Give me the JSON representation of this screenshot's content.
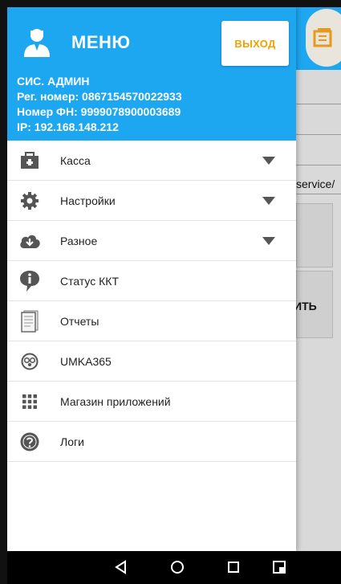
{
  "drawer": {
    "title": "МЕНЮ",
    "logout_label": "ВЫХОД",
    "user_name": "СИС. АДМИН",
    "reg_number": "Рег. номер: 0867154570022933",
    "fn_number": "Номер ФН: 9999078900003689",
    "ip": "IP: 192.168.148.212",
    "items": [
      {
        "label": "Касса",
        "icon": "cash-register-icon",
        "expandable": true
      },
      {
        "label": "Настройки",
        "icon": "gear-icon",
        "expandable": true
      },
      {
        "label": "Разное",
        "icon": "cloud-download-icon",
        "expandable": true
      },
      {
        "label": "Статус ККТ",
        "icon": "info-bubble-icon",
        "expandable": false
      },
      {
        "label": "Отчеты",
        "icon": "document-icon",
        "expandable": false
      },
      {
        "label": "UMKA365",
        "icon": "umka-logo-icon",
        "expandable": false
      },
      {
        "label": "Магазин приложений",
        "icon": "app-grid-icon",
        "expandable": false
      },
      {
        "label": "Логи",
        "icon": "help-circle-icon",
        "expandable": false
      }
    ]
  },
  "background": {
    "url_fragment": "service/",
    "button_fragment": "ИТЬ"
  },
  "colors": {
    "header_blue": "#1ea7f1",
    "logout_text": "#f0a300",
    "icon_gray": "#555555"
  }
}
